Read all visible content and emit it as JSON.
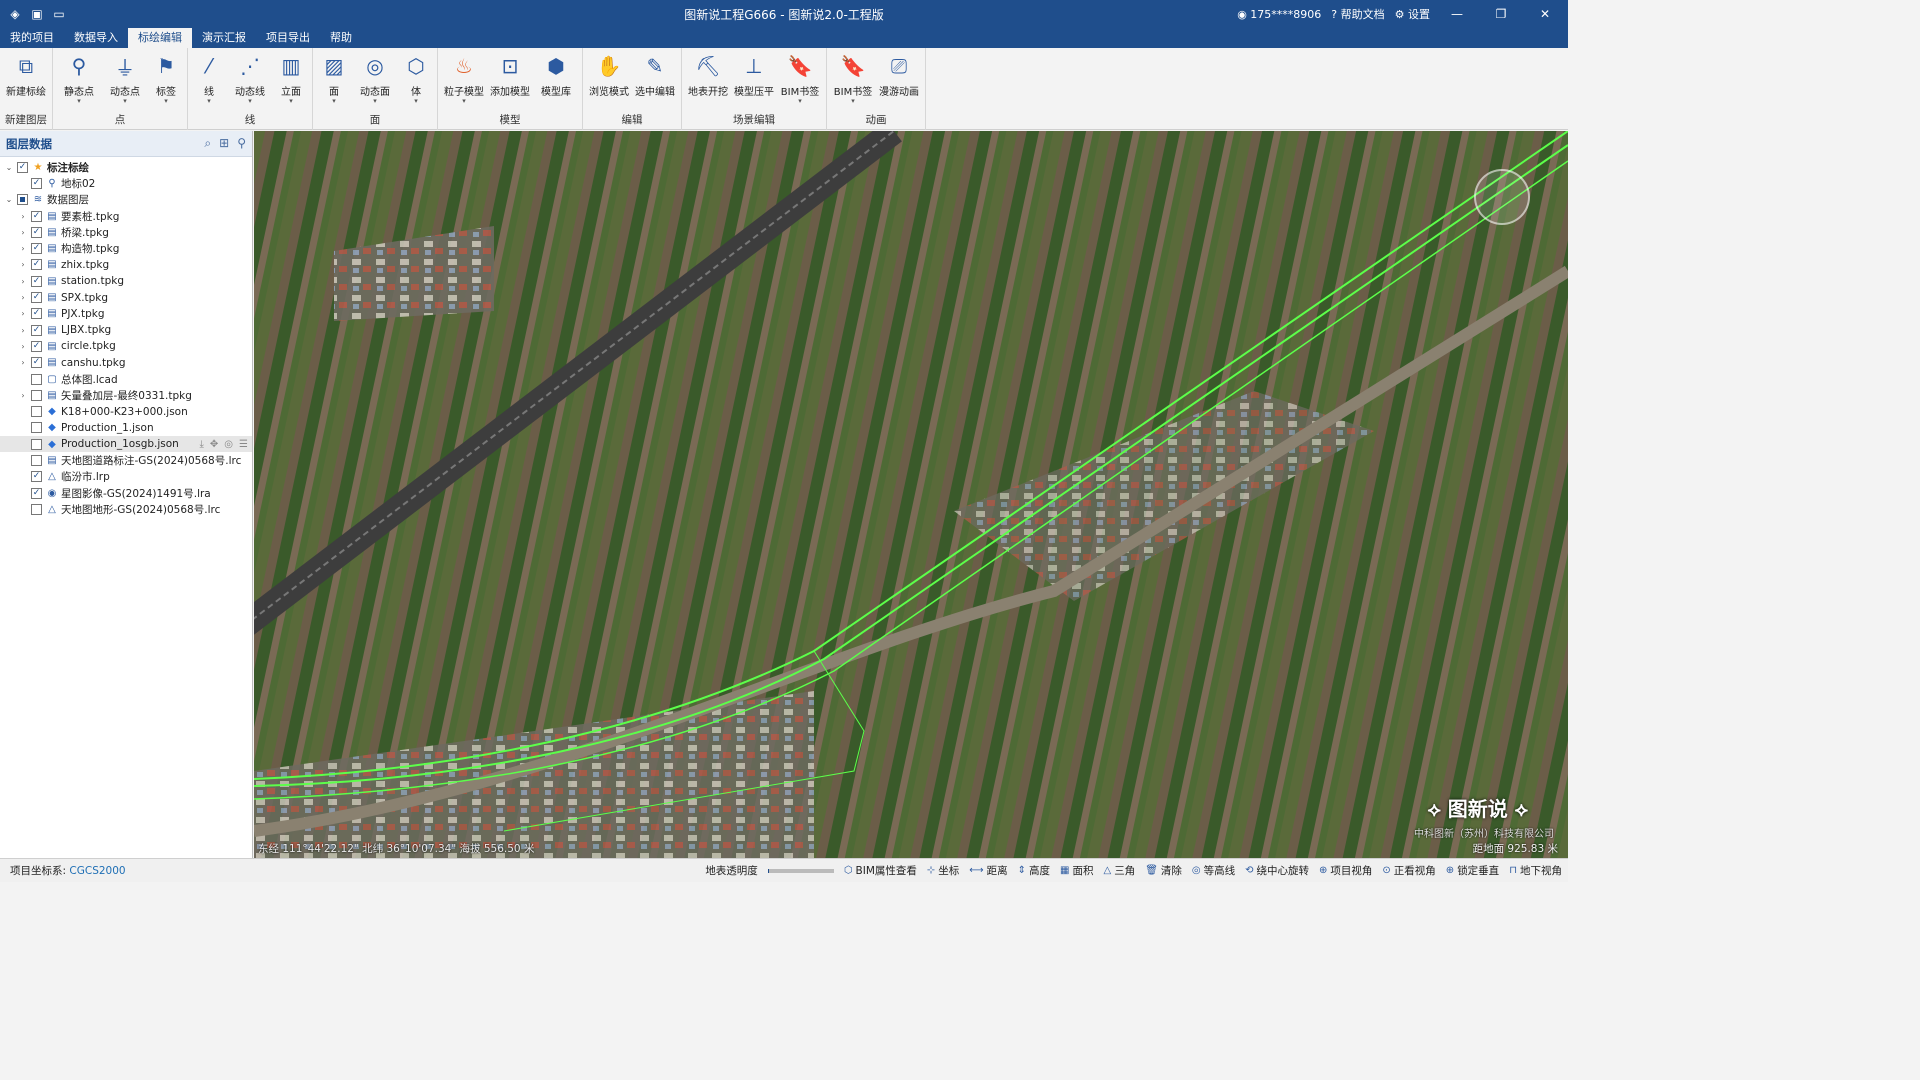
{
  "window": {
    "title": "图新说工程G666 - 图新说2.0-工程版",
    "user": "175****8906",
    "help": "帮助文档",
    "settings": "设置",
    "controls": [
      "—",
      "❐",
      "✕"
    ]
  },
  "menu_tabs": [
    "我的项目",
    "数据导入",
    "标绘编辑",
    "演示汇报",
    "项目导出",
    "帮助"
  ],
  "active_tab": "标绘编辑",
  "ribbon_groups": [
    {
      "label": "新建图层",
      "buttons": [
        {
          "label": "新建标绘",
          "icon": "layers-add-icon",
          "dropdown": false
        }
      ]
    },
    {
      "label": "点",
      "buttons": [
        {
          "label": "静态点",
          "icon": "pin-icon",
          "dropdown": true
        },
        {
          "label": "动态点",
          "icon": "dynamic-point-icon",
          "dropdown": true
        },
        {
          "label": "标签",
          "icon": "tag-icon",
          "dropdown": true
        }
      ]
    },
    {
      "label": "线",
      "buttons": [
        {
          "label": "线",
          "icon": "line-icon",
          "dropdown": true
        },
        {
          "label": "动态线",
          "icon": "dynamic-line-icon",
          "dropdown": true
        },
        {
          "label": "立面",
          "icon": "facade-icon",
          "dropdown": true
        }
      ]
    },
    {
      "label": "面",
      "buttons": [
        {
          "label": "面",
          "icon": "polygon-icon",
          "dropdown": true
        },
        {
          "label": "动态面",
          "icon": "dynamic-surface-icon",
          "dropdown": true
        },
        {
          "label": "体",
          "icon": "cube-icon",
          "dropdown": true
        }
      ]
    },
    {
      "label": "模型",
      "buttons": [
        {
          "label": "粒子模型",
          "icon": "fire-icon",
          "dropdown": true
        },
        {
          "label": "添加模型",
          "icon": "add-model-icon",
          "dropdown": false
        },
        {
          "label": "模型库",
          "icon": "model-library-icon",
          "dropdown": false
        }
      ]
    },
    {
      "label": "编辑",
      "buttons": [
        {
          "label": "浏览模式",
          "icon": "hand-icon",
          "dropdown": false
        },
        {
          "label": "选中编辑",
          "icon": "pencil-icon",
          "dropdown": false
        }
      ]
    },
    {
      "label": "场景编辑",
      "buttons": [
        {
          "label": "地表开挖",
          "icon": "excavate-icon",
          "dropdown": false
        },
        {
          "label": "模型压平",
          "icon": "flatten-icon",
          "dropdown": false
        },
        {
          "label": "BIM书签",
          "icon": "bim-bookmark-icon",
          "dropdown": true
        }
      ]
    },
    {
      "label": "动画",
      "buttons": [
        {
          "label": "BIM书签",
          "icon": "bim-bookmark-icon",
          "dropdown": true
        },
        {
          "label": "漫游动画",
          "icon": "camera-path-icon",
          "dropdown": false
        }
      ]
    }
  ],
  "layer_panel": {
    "title": "图层数据",
    "tree": [
      {
        "label": "标注标绘",
        "level": 0,
        "expand": "v",
        "checked": "checked",
        "icon": "star-icon",
        "bold": true
      },
      {
        "label": "地标02",
        "level": 1,
        "expand": "",
        "checked": "checked",
        "icon": "pin-icon"
      },
      {
        "label": "数据图层",
        "level": 0,
        "expand": "v",
        "checked": "partial",
        "icon": "layers-icon"
      },
      {
        "label": "要素桩.tpkg",
        "level": 1,
        "expand": ">",
        "checked": "checked",
        "icon": "file-icon"
      },
      {
        "label": "桥梁.tpkg",
        "level": 1,
        "expand": ">",
        "checked": "checked",
        "icon": "file-icon"
      },
      {
        "label": "构造物.tpkg",
        "level": 1,
        "expand": ">",
        "checked": "checked",
        "icon": "file-icon"
      },
      {
        "label": "zhix.tpkg",
        "level": 1,
        "expand": ">",
        "checked": "checked",
        "icon": "file-icon"
      },
      {
        "label": "station.tpkg",
        "level": 1,
        "expand": ">",
        "checked": "checked",
        "icon": "file-icon"
      },
      {
        "label": "SPX.tpkg",
        "level": 1,
        "expand": ">",
        "checked": "checked",
        "icon": "file-icon"
      },
      {
        "label": "PJX.tpkg",
        "level": 1,
        "expand": ">",
        "checked": "checked",
        "icon": "file-icon"
      },
      {
        "label": "LJBX.tpkg",
        "level": 1,
        "expand": ">",
        "checked": "checked",
        "icon": "file-icon"
      },
      {
        "label": "circle.tpkg",
        "level": 1,
        "expand": ">",
        "checked": "checked",
        "icon": "file-icon"
      },
      {
        "label": "canshu.tpkg",
        "level": 1,
        "expand": ">",
        "checked": "checked",
        "icon": "file-icon"
      },
      {
        "label": "总体图.lcad",
        "level": 1,
        "expand": "",
        "checked": "unchecked",
        "icon": "cad-icon"
      },
      {
        "label": "矢量叠加层-最终0331.tpkg",
        "level": 1,
        "expand": ">",
        "checked": "unchecked",
        "icon": "file-icon"
      },
      {
        "label": "K18+000-K23+000.json",
        "level": 1,
        "expand": "",
        "checked": "unchecked",
        "icon": "diamond-icon"
      },
      {
        "label": "Production_1.json",
        "level": 1,
        "expand": "",
        "checked": "unchecked",
        "icon": "diamond-icon"
      },
      {
        "label": "Production_1osgb.json",
        "level": 1,
        "expand": "",
        "checked": "unchecked",
        "icon": "diamond-icon",
        "selected": true
      },
      {
        "label": "天地图道路标注-GS(2024)0568号.lrc",
        "level": 1,
        "expand": "",
        "checked": "unchecked",
        "icon": "file-icon"
      },
      {
        "label": "临汾市.lrp",
        "level": 1,
        "expand": "",
        "checked": "checked",
        "icon": "terrain-icon"
      },
      {
        "label": "星图影像-GS(2024)1491号.lra",
        "level": 1,
        "expand": "",
        "checked": "checked",
        "icon": "globe-icon"
      },
      {
        "label": "天地图地形-GS(2024)0568号.lrc",
        "level": 1,
        "expand": "",
        "checked": "unchecked",
        "icon": "terrain-icon"
      }
    ]
  },
  "map": {
    "coords": "东经 111°44'22.12\"  北纬 36°10'07.34\"  海拔 556.50 米",
    "distance": "距地面 925.83 米",
    "brand": "⟡ 图新说 ⟡",
    "company": "中科图新（苏州）科技有限公司"
  },
  "status": {
    "crs_label": "项目坐标系:",
    "crs_value": "CGCS2000",
    "opacity_label": "地表透明度",
    "opacity_value": 0.02,
    "tools": [
      "BIM属性查看",
      "坐标",
      "距离",
      "高度",
      "面积",
      "三角",
      "清除",
      "等高线",
      "绕中心旋转",
      "项目视角",
      "正看视角",
      "锁定垂直",
      "地下视角"
    ]
  },
  "colors": {
    "titlebar": "#1f4e8c",
    "accent": "#1f4e8c",
    "route_line": "#5cff4a"
  }
}
